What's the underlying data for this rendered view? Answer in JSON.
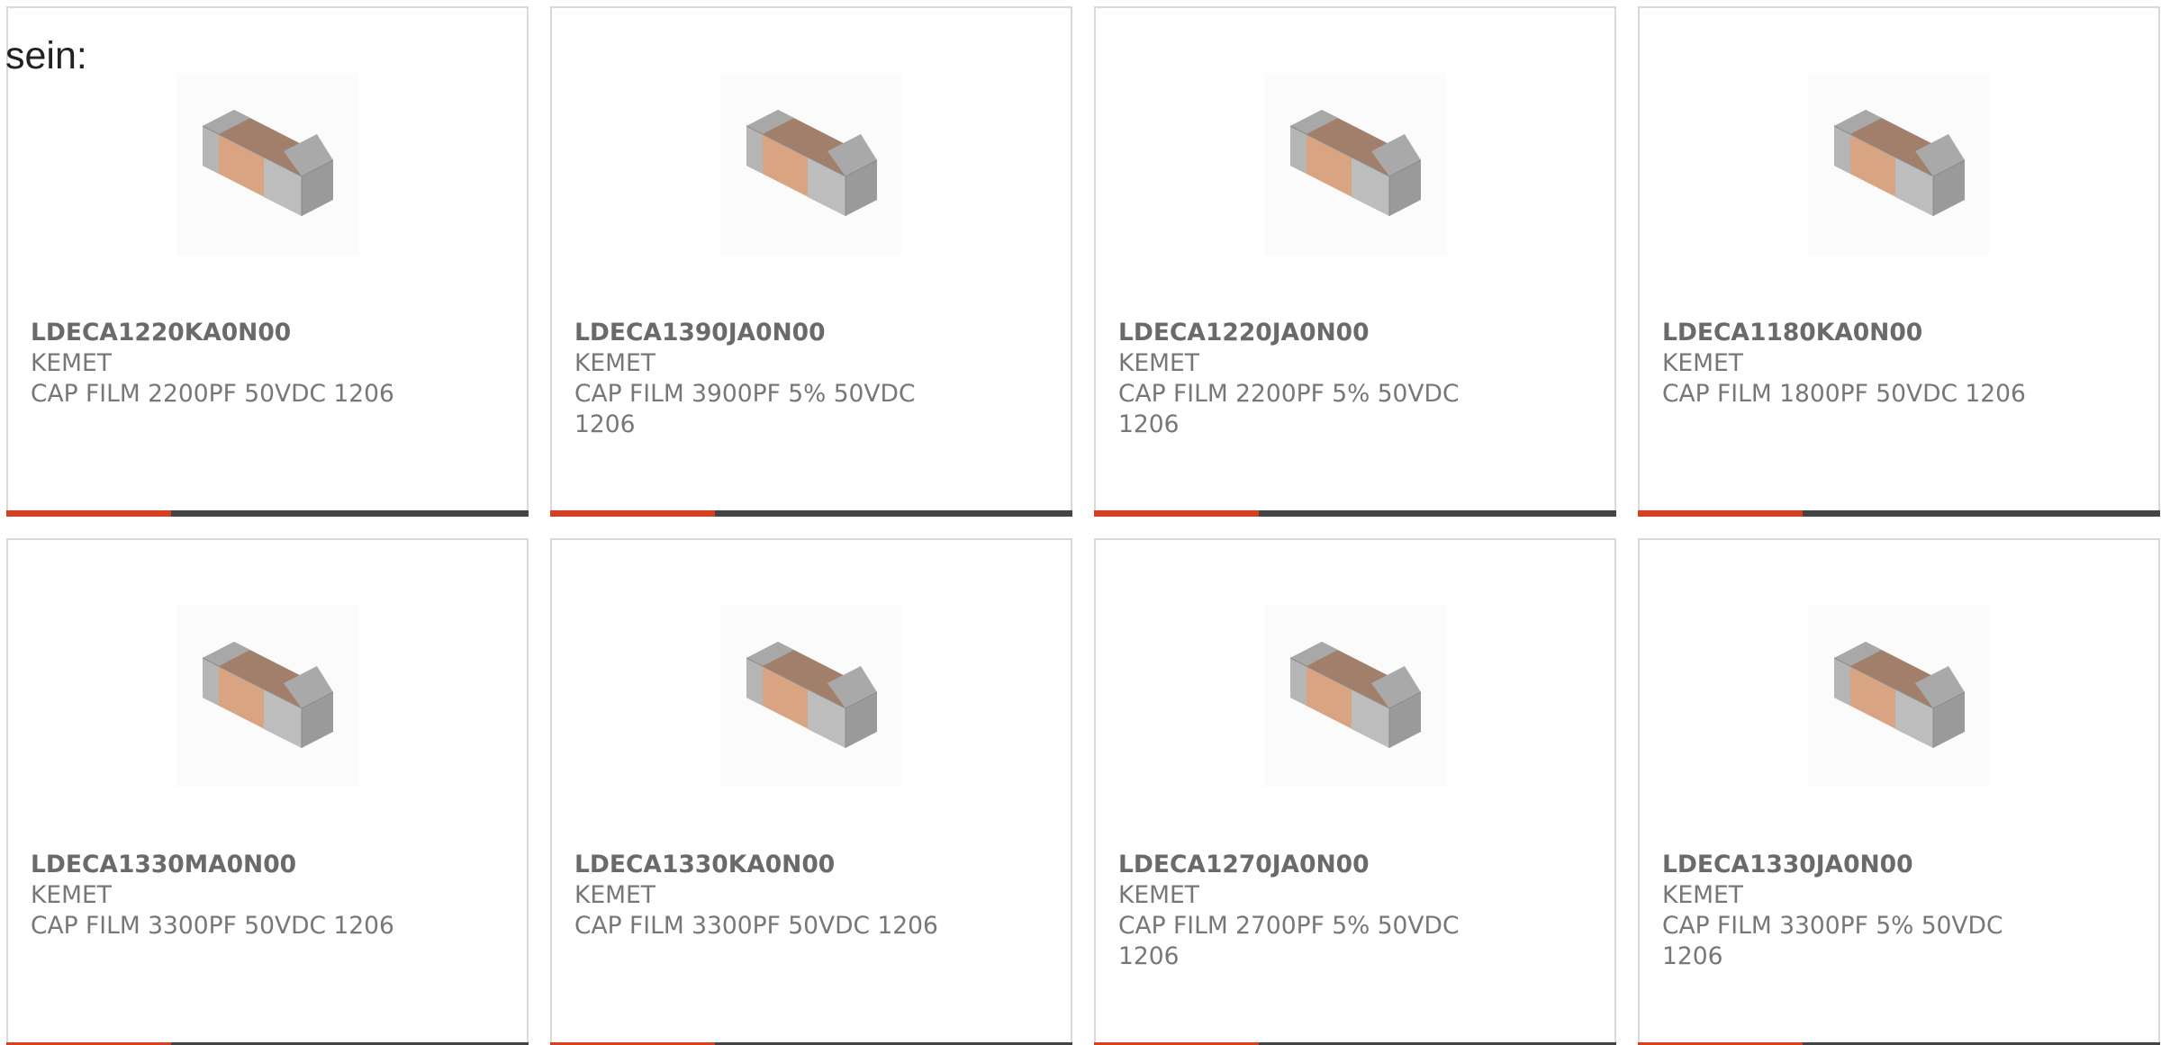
{
  "intro_text": "sein:",
  "colors": {
    "accent": "#d64020",
    "bar": "#444444",
    "border": "#d9d9d9",
    "text": "#777777"
  },
  "products": [
    {
      "part_number": "LDECA1220KA0N00",
      "manufacturer": "KEMET",
      "description": "CAP FILM 2200PF 50VDC 1206",
      "image_icon": "smd-capacitor-icon"
    },
    {
      "part_number": "LDECA1390JA0N00",
      "manufacturer": "KEMET",
      "description": "CAP FILM 3900PF 5% 50VDC 1206",
      "image_icon": "smd-capacitor-icon"
    },
    {
      "part_number": "LDECA1220JA0N00",
      "manufacturer": "KEMET",
      "description": "CAP FILM 2200PF 5% 50VDC 1206",
      "image_icon": "smd-capacitor-icon"
    },
    {
      "part_number": "LDECA1180KA0N00",
      "manufacturer": "KEMET",
      "description": "CAP FILM 1800PF 50VDC 1206",
      "image_icon": "smd-capacitor-icon"
    },
    {
      "part_number": "LDECA1330MA0N00",
      "manufacturer": "KEMET",
      "description": "CAP FILM 3300PF 50VDC 1206",
      "image_icon": "smd-capacitor-icon"
    },
    {
      "part_number": "LDECA1330KA0N00",
      "manufacturer": "KEMET",
      "description": "CAP FILM 3300PF 50VDC 1206",
      "image_icon": "smd-capacitor-icon"
    },
    {
      "part_number": "LDECA1270JA0N00",
      "manufacturer": "KEMET",
      "description": "CAP FILM 2700PF 5% 50VDC 1206",
      "image_icon": "smd-capacitor-icon"
    },
    {
      "part_number": "LDECA1330JA0N00",
      "manufacturer": "KEMET",
      "description": "CAP FILM 3300PF 5% 50VDC 1206",
      "image_icon": "smd-capacitor-icon"
    }
  ]
}
